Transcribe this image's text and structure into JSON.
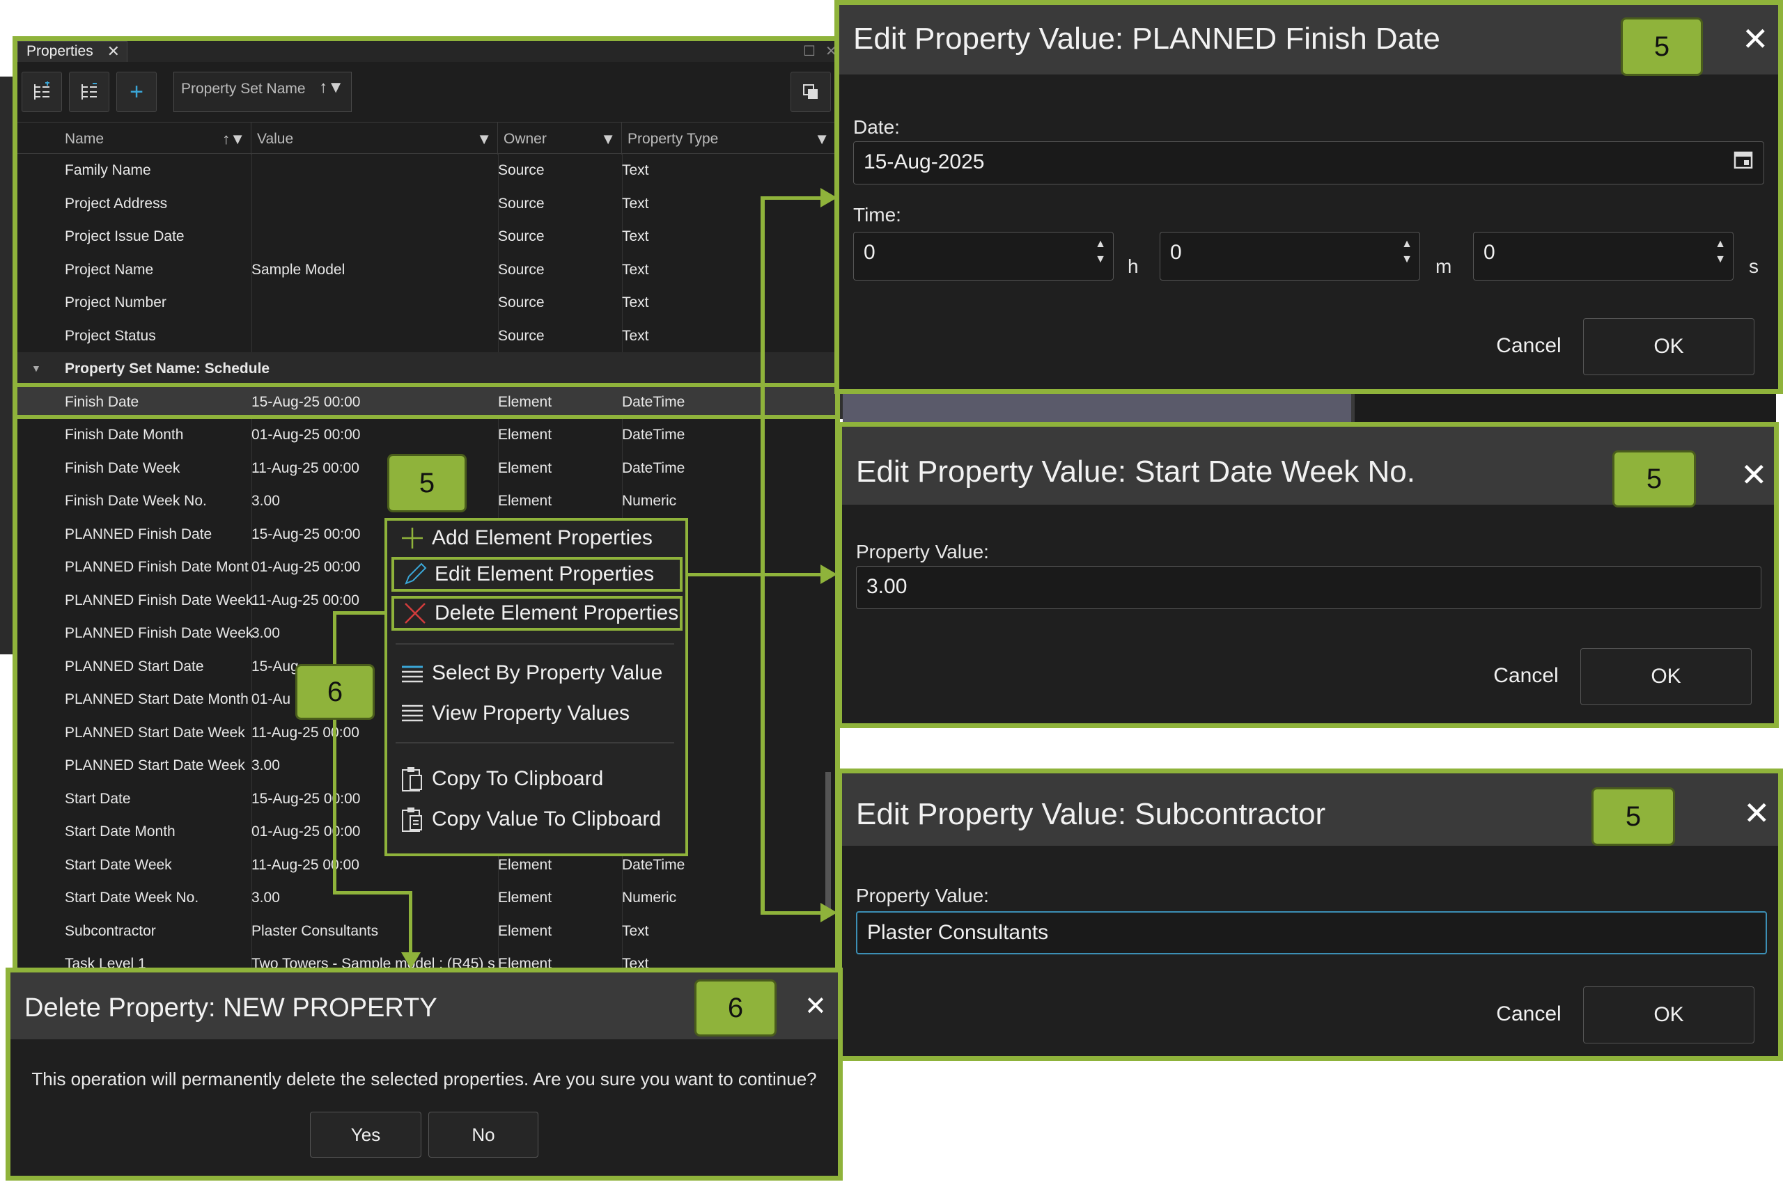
{
  "properties_panel": {
    "tab_label": "Properties",
    "toolbar": {
      "group_field_label": "Property Set Name"
    },
    "columns": [
      "Name",
      "Value",
      "Owner",
      "Property Type"
    ],
    "rows_top": [
      {
        "name": "Family Name",
        "value": "",
        "owner": "Source",
        "type": "Text"
      },
      {
        "name": "Project Address",
        "value": "",
        "owner": "Source",
        "type": "Text"
      },
      {
        "name": "Project Issue Date",
        "value": "",
        "owner": "Source",
        "type": "Text"
      },
      {
        "name": "Project Name",
        "value": "Sample Model",
        "owner": "Source",
        "type": "Text"
      },
      {
        "name": "Project Number",
        "value": "",
        "owner": "Source",
        "type": "Text"
      },
      {
        "name": "Project Status",
        "value": "",
        "owner": "Source",
        "type": "Text"
      }
    ],
    "group_label": "Property Set Name: Schedule",
    "rows_schedule": [
      {
        "name": "Finish Date",
        "value": "15-Aug-25 00:00",
        "owner": "Element",
        "type": "DateTime"
      },
      {
        "name": "Finish Date Month",
        "value": "01-Aug-25 00:00",
        "owner": "Element",
        "type": "DateTime"
      },
      {
        "name": "Finish Date Week",
        "value": "11-Aug-25 00:00",
        "owner": "Element",
        "type": "DateTime"
      },
      {
        "name": "Finish Date Week No.",
        "value": "3.00",
        "owner": "Element",
        "type": "Numeric"
      },
      {
        "name": "PLANNED Finish Date",
        "value": "15-Aug-25 00:00",
        "owner": "",
        "type": ""
      },
      {
        "name": "PLANNED Finish Date Mont",
        "value": "01-Aug-25 00:00",
        "owner": "",
        "type": ""
      },
      {
        "name": "PLANNED Finish Date Week",
        "value": "11-Aug-25 00:00",
        "owner": "",
        "type": ""
      },
      {
        "name": "PLANNED Finish Date Week",
        "value": "3.00",
        "owner": "",
        "type": ""
      },
      {
        "name": "PLANNED Start Date",
        "value": "15-Aug",
        "owner": "",
        "type": ""
      },
      {
        "name": "PLANNED Start Date Month",
        "value": "01-Au",
        "owner": "",
        "type": ""
      },
      {
        "name": "PLANNED Start Date Week",
        "value": "11-Aug-25 00:00",
        "owner": "",
        "type": ""
      },
      {
        "name": "PLANNED Start Date Week",
        "value": "3.00",
        "owner": "",
        "type": ""
      },
      {
        "name": "Start Date",
        "value": "15-Aug-25 00:00",
        "owner": "",
        "type": ""
      },
      {
        "name": "Start Date Month",
        "value": "01-Aug-25 00:00",
        "owner": "",
        "type": ""
      },
      {
        "name": "Start Date Week",
        "value": "11-Aug-25 00:00",
        "owner": "Element",
        "type": "DateTime"
      },
      {
        "name": "Start Date Week No.",
        "value": "3.00",
        "owner": "Element",
        "type": "Numeric"
      },
      {
        "name": "Subcontractor",
        "value": "Plaster Consultants",
        "owner": "Element",
        "type": "Text"
      },
      {
        "name": "Task Level 1",
        "value": "Two Towers - Sample model : (R45) s",
        "owner": "Element",
        "type": "Text"
      }
    ]
  },
  "context_menu": {
    "items": [
      {
        "label": "Add Element Properties",
        "icon": "plus-icon"
      },
      {
        "label": "Edit Element Properties",
        "icon": "pencil-icon"
      },
      {
        "label": "Delete Element Properties",
        "icon": "red-x-icon"
      },
      {
        "label": "Select By Property Value",
        "icon": "select-list-icon"
      },
      {
        "label": "View Property Values",
        "icon": "list-icon"
      },
      {
        "label": "Copy To Clipboard",
        "icon": "clipboard-icon"
      },
      {
        "label": "Copy Value To Clipboard",
        "icon": "clipboard-value-icon"
      }
    ]
  },
  "badges": {
    "five": "5",
    "six": "6"
  },
  "dialog_date": {
    "title": "Edit Property Value: PLANNED Finish Date",
    "date_label": "Date:",
    "date_value": "15-Aug-2025",
    "time_label": "Time:",
    "hours": "0",
    "minutes": "0",
    "seconds": "0",
    "unit_h": "h",
    "unit_m": "m",
    "unit_s": "s",
    "cancel": "Cancel",
    "ok": "OK"
  },
  "dialog_week": {
    "title": "Edit Property Value: Start Date Week No.",
    "label": "Property Value:",
    "value": "3.00",
    "cancel": "Cancel",
    "ok": "OK"
  },
  "dialog_sub": {
    "title": "Edit Property Value: Subcontractor",
    "label": "Property Value:",
    "value": "Plaster Consultants",
    "cancel": "Cancel",
    "ok": "OK"
  },
  "dialog_delete": {
    "title": "Delete Property: NEW PROPERTY",
    "message": "This operation will permanently delete the selected properties. Are you sure you want to continue?",
    "yes": "Yes",
    "no": "No"
  },
  "colors": {
    "accent": "#8fb33b",
    "focus": "#3c8fb5",
    "danger": "#d23c3c"
  }
}
